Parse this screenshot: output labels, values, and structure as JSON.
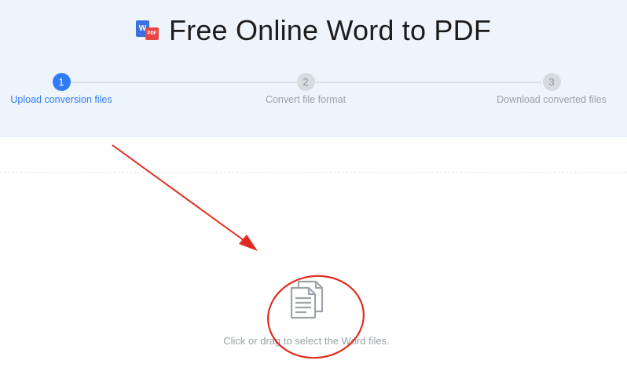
{
  "header": {
    "title": "Free Online Word to PDF",
    "logo": {
      "word_letter": "W",
      "pdf_text": "PDF",
      "icon": "word-to-pdf-icon"
    }
  },
  "steps": [
    {
      "number": "1",
      "label": "Upload conversion files",
      "active": true
    },
    {
      "number": "2",
      "label": "Convert file format",
      "active": false
    },
    {
      "number": "3",
      "label": "Download converted files",
      "active": false
    }
  ],
  "dropzone": {
    "icon": "document-icon",
    "hint": "Click or drag to select the Word files."
  },
  "annotations": {
    "color": "#e02b20",
    "shapes": [
      "arrow",
      "circle"
    ]
  },
  "colors": {
    "accent": "#2f7cf6",
    "header_bg": "#eef4fb",
    "inactive": "#d6dbe0"
  }
}
